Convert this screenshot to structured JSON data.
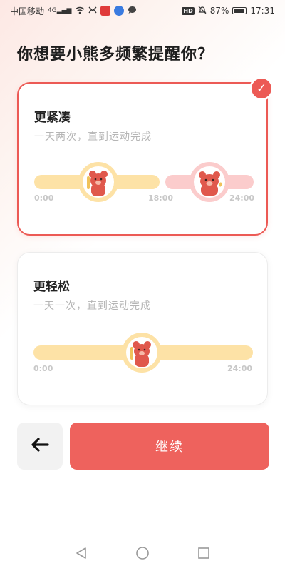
{
  "status_bar": {
    "carrier": "中国移动",
    "network": "4G",
    "battery": "87%",
    "time": "17:31",
    "hd": "HD"
  },
  "page": {
    "title": "你想要小熊多频繁提醒你？"
  },
  "options": [
    {
      "title": "更紧凑",
      "subtitle": "一天两次，直到运动完成",
      "selected": true,
      "time_labels": [
        "0:00",
        "18:00",
        "24:00"
      ]
    },
    {
      "title": "更轻松",
      "subtitle": "一天一次，直到运动完成",
      "selected": false,
      "time_labels": [
        "0:00",
        "24:00"
      ]
    }
  ],
  "actions": {
    "back_icon": "arrow-left-icon",
    "continue_label": "继续"
  },
  "colors": {
    "accent": "#ee625d",
    "track_yellow": "#fde2a6",
    "track_pink": "#fbcccc",
    "bear": "#e0584c"
  }
}
